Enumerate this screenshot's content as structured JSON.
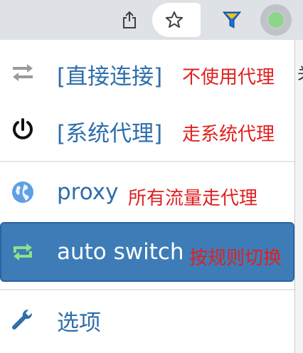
{
  "browser_toolbar": {
    "share_icon": "share-icon",
    "bookmark_icon": "star-icon",
    "extension_icon": "funnel-icon",
    "proxy_extension_icon": "omega-status-icon"
  },
  "menu": {
    "direct": {
      "label": "[直接连接]",
      "note": "不使用代理",
      "icon": "arrows-exchange-icon"
    },
    "system": {
      "label": "[系统代理]",
      "note": "走系统代理",
      "icon": "power-icon"
    },
    "proxy": {
      "label": "proxy",
      "note": "所有流量走代理",
      "icon": "globe-icon"
    },
    "auto_switch": {
      "label": "auto switch",
      "note": "按规则切换",
      "icon": "repeat-icon",
      "active": true
    },
    "options": {
      "label": "选项",
      "icon": "wrench-icon"
    }
  },
  "background_page": {
    "partial_char": "关"
  },
  "colors": {
    "label_blue": "#2f6eab",
    "note_red": "#e02020",
    "active_bg": "#3d7cb7",
    "toolbar_bg": "#dee1e6"
  }
}
